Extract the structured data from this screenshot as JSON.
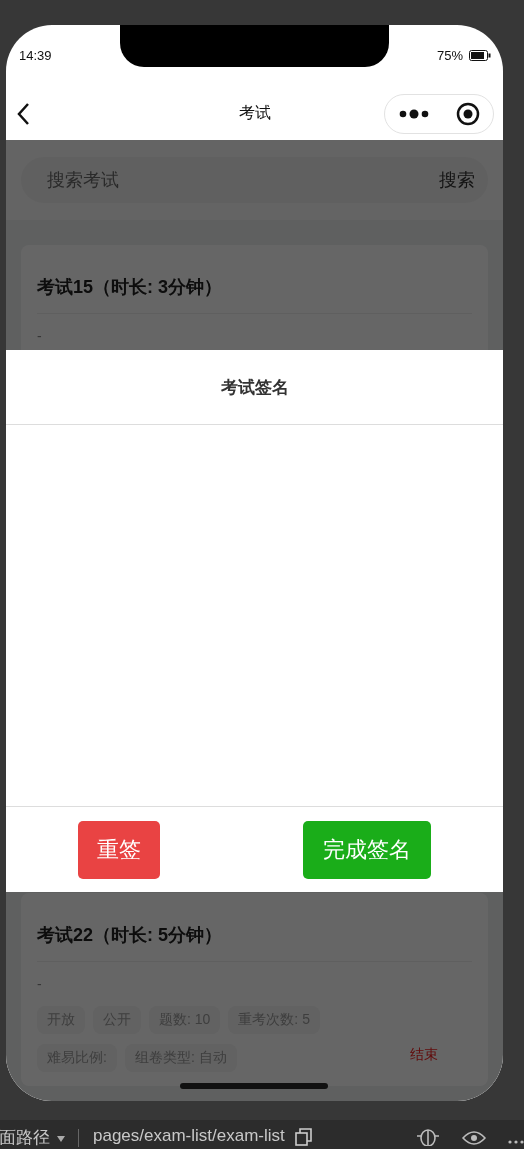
{
  "status_bar": {
    "time": "14:39",
    "battery": "75%"
  },
  "nav": {
    "title": "考试"
  },
  "search": {
    "placeholder": "搜索考试",
    "button": "搜索"
  },
  "exams": [
    {
      "title": "考试15（时长: 3分钟）",
      "description": "-"
    },
    {
      "title": "考试22（时长: 5分钟）",
      "description": "-",
      "tags": [
        "开放",
        "公开",
        "题数: 10",
        "重考次数: 5",
        "难易比例:",
        "组卷类型: 自动"
      ],
      "status": "结束"
    }
  ],
  "dialog": {
    "title": "考试签名",
    "buttons": [
      {
        "label": "重签",
        "kind": "reset"
      },
      {
        "label": "完成签名",
        "kind": "confirm"
      }
    ]
  },
  "devtools": {
    "path_label": "面路径",
    "path": "pages/exam-list/exam-list"
  }
}
